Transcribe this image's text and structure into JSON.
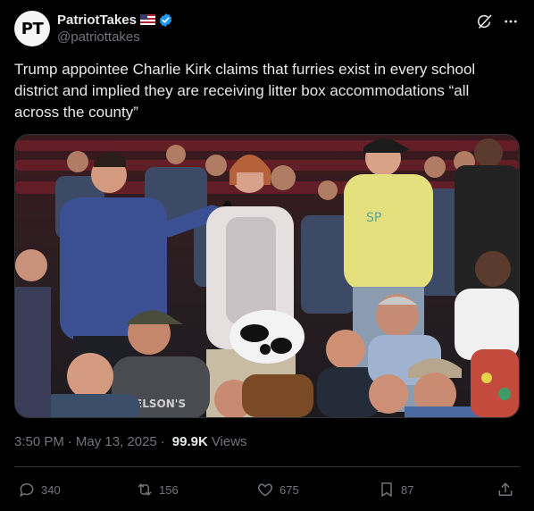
{
  "author": {
    "avatar_initials": "PT",
    "display_name": "PatriotTakes",
    "handle": "@patriottakes",
    "flag": "us-flag-emoji",
    "verified": true,
    "verified_color": "#1d9bf0"
  },
  "header_icons": [
    "grok-icon",
    "more-icon"
  ],
  "tweet": {
    "text": "Trump appointee Charlie Kirk claims that furries exist in every school district and implied they are receiving litter box accommodations “all across the county”"
  },
  "media": {
    "type": "video",
    "shirt_text": "NELSON'S"
  },
  "meta": {
    "time": "3:50 PM",
    "date": "May 13, 2025",
    "views_count": "99.9K",
    "views_label": "Views"
  },
  "actions": {
    "replies": "340",
    "reposts": "156",
    "likes": "675",
    "bookmarks": "87"
  },
  "colors": {
    "background": "#000000",
    "text": "#e7e9ea",
    "secondary": "#71767b",
    "border": "#2f3336",
    "accent": "#1d9bf0"
  }
}
